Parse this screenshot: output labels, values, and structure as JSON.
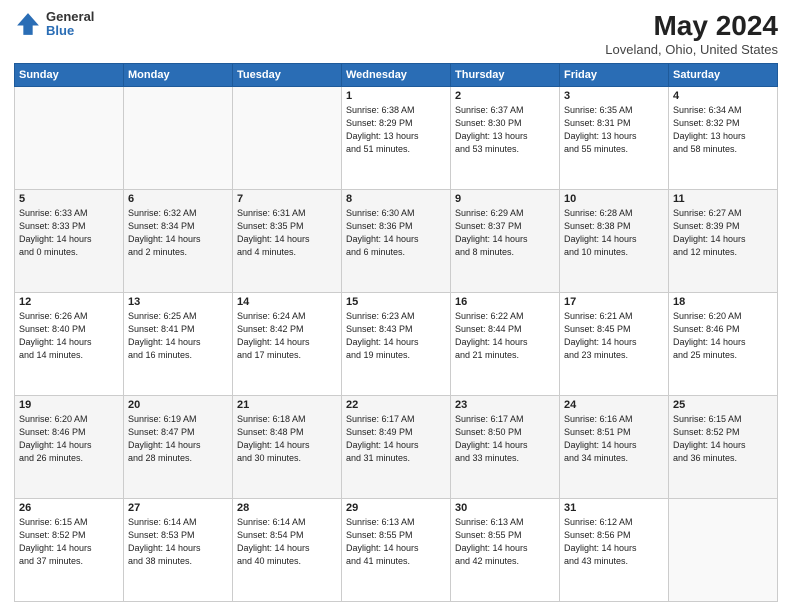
{
  "header": {
    "logo_general": "General",
    "logo_blue": "Blue",
    "title": "May 2024",
    "subtitle": "Loveland, Ohio, United States"
  },
  "days_of_week": [
    "Sunday",
    "Monday",
    "Tuesday",
    "Wednesday",
    "Thursday",
    "Friday",
    "Saturday"
  ],
  "weeks": [
    [
      {
        "day": "",
        "info": ""
      },
      {
        "day": "",
        "info": ""
      },
      {
        "day": "",
        "info": ""
      },
      {
        "day": "1",
        "info": "Sunrise: 6:38 AM\nSunset: 8:29 PM\nDaylight: 13 hours\nand 51 minutes."
      },
      {
        "day": "2",
        "info": "Sunrise: 6:37 AM\nSunset: 8:30 PM\nDaylight: 13 hours\nand 53 minutes."
      },
      {
        "day": "3",
        "info": "Sunrise: 6:35 AM\nSunset: 8:31 PM\nDaylight: 13 hours\nand 55 minutes."
      },
      {
        "day": "4",
        "info": "Sunrise: 6:34 AM\nSunset: 8:32 PM\nDaylight: 13 hours\nand 58 minutes."
      }
    ],
    [
      {
        "day": "5",
        "info": "Sunrise: 6:33 AM\nSunset: 8:33 PM\nDaylight: 14 hours\nand 0 minutes."
      },
      {
        "day": "6",
        "info": "Sunrise: 6:32 AM\nSunset: 8:34 PM\nDaylight: 14 hours\nand 2 minutes."
      },
      {
        "day": "7",
        "info": "Sunrise: 6:31 AM\nSunset: 8:35 PM\nDaylight: 14 hours\nand 4 minutes."
      },
      {
        "day": "8",
        "info": "Sunrise: 6:30 AM\nSunset: 8:36 PM\nDaylight: 14 hours\nand 6 minutes."
      },
      {
        "day": "9",
        "info": "Sunrise: 6:29 AM\nSunset: 8:37 PM\nDaylight: 14 hours\nand 8 minutes."
      },
      {
        "day": "10",
        "info": "Sunrise: 6:28 AM\nSunset: 8:38 PM\nDaylight: 14 hours\nand 10 minutes."
      },
      {
        "day": "11",
        "info": "Sunrise: 6:27 AM\nSunset: 8:39 PM\nDaylight: 14 hours\nand 12 minutes."
      }
    ],
    [
      {
        "day": "12",
        "info": "Sunrise: 6:26 AM\nSunset: 8:40 PM\nDaylight: 14 hours\nand 14 minutes."
      },
      {
        "day": "13",
        "info": "Sunrise: 6:25 AM\nSunset: 8:41 PM\nDaylight: 14 hours\nand 16 minutes."
      },
      {
        "day": "14",
        "info": "Sunrise: 6:24 AM\nSunset: 8:42 PM\nDaylight: 14 hours\nand 17 minutes."
      },
      {
        "day": "15",
        "info": "Sunrise: 6:23 AM\nSunset: 8:43 PM\nDaylight: 14 hours\nand 19 minutes."
      },
      {
        "day": "16",
        "info": "Sunrise: 6:22 AM\nSunset: 8:44 PM\nDaylight: 14 hours\nand 21 minutes."
      },
      {
        "day": "17",
        "info": "Sunrise: 6:21 AM\nSunset: 8:45 PM\nDaylight: 14 hours\nand 23 minutes."
      },
      {
        "day": "18",
        "info": "Sunrise: 6:20 AM\nSunset: 8:46 PM\nDaylight: 14 hours\nand 25 minutes."
      }
    ],
    [
      {
        "day": "19",
        "info": "Sunrise: 6:20 AM\nSunset: 8:46 PM\nDaylight: 14 hours\nand 26 minutes."
      },
      {
        "day": "20",
        "info": "Sunrise: 6:19 AM\nSunset: 8:47 PM\nDaylight: 14 hours\nand 28 minutes."
      },
      {
        "day": "21",
        "info": "Sunrise: 6:18 AM\nSunset: 8:48 PM\nDaylight: 14 hours\nand 30 minutes."
      },
      {
        "day": "22",
        "info": "Sunrise: 6:17 AM\nSunset: 8:49 PM\nDaylight: 14 hours\nand 31 minutes."
      },
      {
        "day": "23",
        "info": "Sunrise: 6:17 AM\nSunset: 8:50 PM\nDaylight: 14 hours\nand 33 minutes."
      },
      {
        "day": "24",
        "info": "Sunrise: 6:16 AM\nSunset: 8:51 PM\nDaylight: 14 hours\nand 34 minutes."
      },
      {
        "day": "25",
        "info": "Sunrise: 6:15 AM\nSunset: 8:52 PM\nDaylight: 14 hours\nand 36 minutes."
      }
    ],
    [
      {
        "day": "26",
        "info": "Sunrise: 6:15 AM\nSunset: 8:52 PM\nDaylight: 14 hours\nand 37 minutes."
      },
      {
        "day": "27",
        "info": "Sunrise: 6:14 AM\nSunset: 8:53 PM\nDaylight: 14 hours\nand 38 minutes."
      },
      {
        "day": "28",
        "info": "Sunrise: 6:14 AM\nSunset: 8:54 PM\nDaylight: 14 hours\nand 40 minutes."
      },
      {
        "day": "29",
        "info": "Sunrise: 6:13 AM\nSunset: 8:55 PM\nDaylight: 14 hours\nand 41 minutes."
      },
      {
        "day": "30",
        "info": "Sunrise: 6:13 AM\nSunset: 8:55 PM\nDaylight: 14 hours\nand 42 minutes."
      },
      {
        "day": "31",
        "info": "Sunrise: 6:12 AM\nSunset: 8:56 PM\nDaylight: 14 hours\nand 43 minutes."
      },
      {
        "day": "",
        "info": ""
      }
    ]
  ]
}
